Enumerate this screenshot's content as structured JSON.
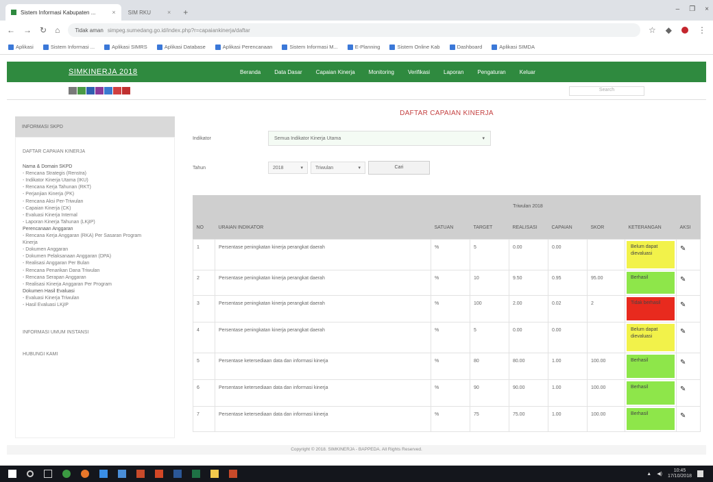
{
  "browser": {
    "tabs": [
      {
        "label": "Sistem Informasi Kabupaten ...",
        "close": "×"
      },
      {
        "label": "SIM RKU",
        "close": "×"
      }
    ],
    "new_tab": "+",
    "window_controls": [
      "–",
      "❐",
      "×"
    ],
    "url_secure_label": "Tidak aman",
    "url": "simpeg.sumedang.go.id/index.php?r=capaiankinerja/daftar",
    "bookmarks": [
      "Aplikasi",
      "Sistem Informasi ...",
      "Aplikasi SIMRS",
      "Aplikasi Database",
      "Aplikasi Perencanaan",
      "Sistem Informasi M...",
      "E-Planning",
      "Sistem Online Kab",
      "Dashboard",
      "Aplikasi SIMDA"
    ]
  },
  "site": {
    "brand": "SIMKINERJA 2018",
    "menu": [
      "Beranda",
      "Data Dasar",
      "Capaian Kinerja",
      "Monitoring",
      "Verifikasi",
      "Laporan",
      "Pengaturan",
      "Keluar"
    ],
    "color_swatches": [
      "#7a7a7a",
      "#4a9a45",
      "#2f5fb0",
      "#8a3a9a",
      "#3a7ad0",
      "#d04040",
      "#c03030"
    ],
    "search_placeholder": "Search"
  },
  "sidebar": {
    "title": "INFORMASI SKPD",
    "top_link": "DAFTAR CAPAIAN KINERJA",
    "items": [
      {
        "text": "Nama & Domain SKPD",
        "head": true
      },
      {
        "text": "- Rencana Strategis (Renstra)",
        "head": false
      },
      {
        "text": "- Indikator Kinerja Utama (IKU)",
        "head": false
      },
      {
        "text": "- Rencana Kerja Tahunan (RKT)",
        "head": false
      },
      {
        "text": "- Perjanjian Kinerja (PK)",
        "head": false
      },
      {
        "text": "- Rencana Aksi Per-Triwulan",
        "head": false
      },
      {
        "text": "- Capaian Kinerja (CK)",
        "head": false
      },
      {
        "text": "- Evaluasi Kinerja Internal",
        "head": false
      },
      {
        "text": "- Laporan Kinerja Tahunan (LKjIP)",
        "head": false
      },
      {
        "text": "Perencanaan Anggaran",
        "head": true
      },
      {
        "text": "- Rencana Kerja Anggaran (RKA) Per Sasaran Program",
        "head": false
      },
      {
        "text": "Kinerja",
        "head": false
      },
      {
        "text": "- Dokumen Anggaran",
        "head": false
      },
      {
        "text": "- Dokumen Pelaksanaan Anggaran (DPA)",
        "head": false
      },
      {
        "text": "- Realisasi Anggaran Per Bulan",
        "head": false
      },
      {
        "text": "- Rencana Penarikan Dana Triwulan",
        "head": false
      },
      {
        "text": "- Rencana Serapan Anggaran",
        "head": false
      },
      {
        "text": "- Realisasi Kinerja Anggaran Per Program",
        "head": false
      },
      {
        "text": "Dokumen Hasil Evaluasi",
        "head": true
      },
      {
        "text": "- Evaluasi Kinerja Triwulan",
        "head": false
      },
      {
        "text": "- Hasil Evaluasi LKjIP",
        "head": false
      }
    ],
    "footer_links": [
      "INFORMASI UMUM INSTANSI",
      "HUBUNGI KAMI"
    ]
  },
  "main": {
    "title": "DAFTAR CAPAIAN KINERJA",
    "filter_label_1": "Indikator",
    "filter_value_1": "Semua Indikator Kinerja Utama",
    "filter_label_2": "Tahun",
    "year_value": "2018",
    "period_value": "Triwulan",
    "submit_label": "Cari",
    "table": {
      "group_header": "Triwulan 2018",
      "headers": [
        "NO",
        "URAIAN INDIKATOR",
        "SATUAN",
        "TARGET",
        "REALISASI",
        "CAPAIAN",
        "SKOR",
        "KETERANGAN",
        "AKSI"
      ],
      "rows": [
        {
          "no": "1",
          "uraian": "Persentase peningkatan kinerja perangkat daerah",
          "satuan": "%",
          "target": "5",
          "realisasi": "0.00",
          "capaian": "0.00",
          "skor": "",
          "ket": "Belum dapat dievaluasi",
          "ket_color": "#f2f24a"
        },
        {
          "no": "2",
          "uraian": "Persentase peningkatan kinerja perangkat daerah",
          "satuan": "%",
          "target": "10",
          "realisasi": "9.50",
          "capaian": "0.95",
          "skor": "95.00",
          "ket": "Berhasil",
          "ket_color": "#8ee64a"
        },
        {
          "no": "3",
          "uraian": "Persentase peningkatan kinerja perangkat daerah",
          "satuan": "%",
          "target": "100",
          "realisasi": "2.00",
          "capaian": "0.02",
          "skor": "2",
          "ket": "Tidak berhasil",
          "ket_color": "#e82a1e"
        },
        {
          "no": "4",
          "uraian": "Persentase peningkatan kinerja perangkat daerah",
          "satuan": "%",
          "target": "5",
          "realisasi": "0.00",
          "capaian": "0.00",
          "skor": "",
          "ket": "Belum dapat dievaluasi",
          "ket_color": "#f2f24a"
        },
        {
          "no": "5",
          "uraian": "Persentase ketersediaan data dan informasi kinerja",
          "satuan": "%",
          "target": "80",
          "realisasi": "80.00",
          "capaian": "1.00",
          "skor": "100.00",
          "ket": "Berhasil",
          "ket_color": "#8ee64a"
        },
        {
          "no": "6",
          "uraian": "Persentase ketersediaan data dan informasi kinerja",
          "satuan": "%",
          "target": "90",
          "realisasi": "90.00",
          "capaian": "1.00",
          "skor": "100.00",
          "ket": "Berhasil",
          "ket_color": "#8ee64a"
        },
        {
          "no": "7",
          "uraian": "Persentase ketersediaan data dan informasi kinerja",
          "satuan": "%",
          "target": "75",
          "realisasi": "75.00",
          "capaian": "1.00",
          "skor": "100.00",
          "ket": "Berhasil",
          "ket_color": "#8ee64a"
        }
      ]
    }
  },
  "footer": "Copyright © 2018. SIMKINERJA - BAPPEDA. All Rights Reserved.",
  "taskbar": {
    "time": "10:45",
    "date": "17/10/2018"
  }
}
